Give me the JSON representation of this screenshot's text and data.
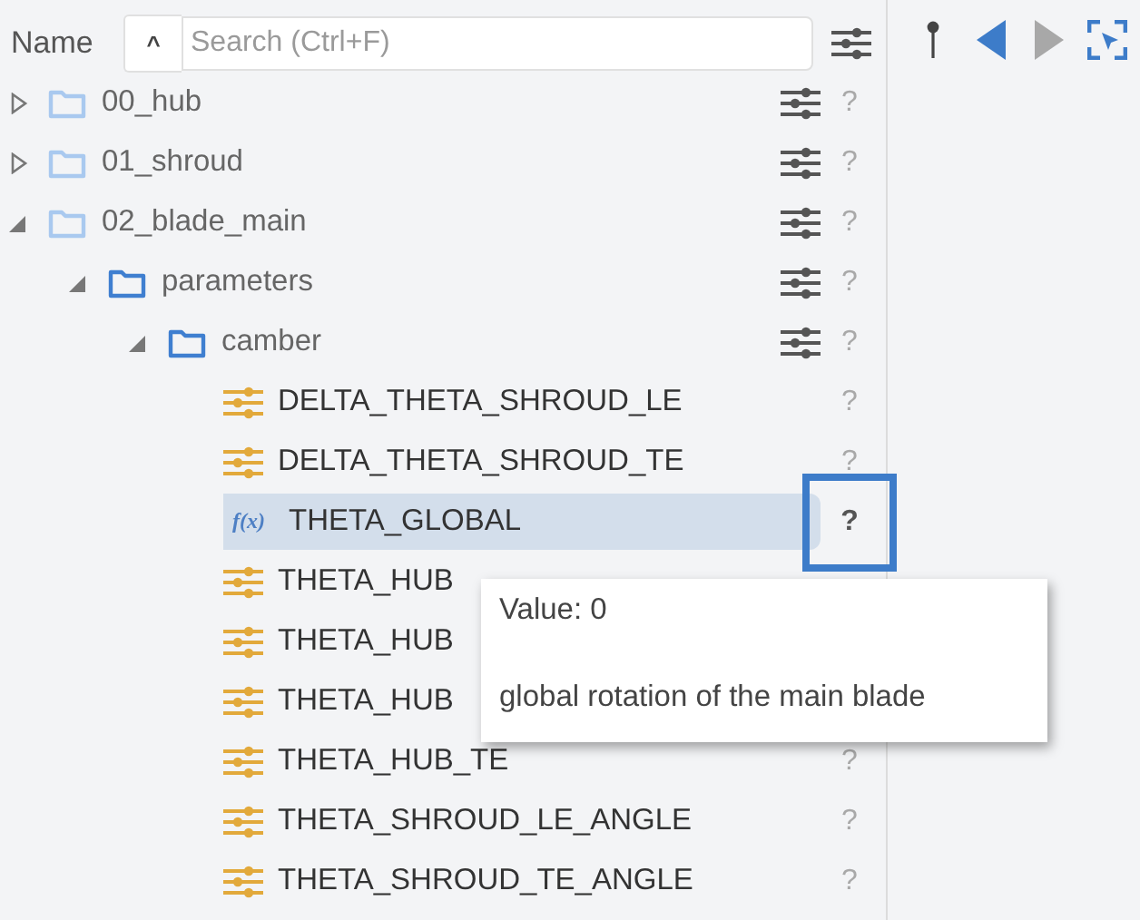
{
  "header": {
    "name_label": "Name",
    "collapse_button": "^",
    "search": {
      "placeholder": "Search (Ctrl+F)"
    }
  },
  "toolbar": [
    {
      "kind": "pin"
    },
    {
      "kind": "back",
      "disabled": false
    },
    {
      "kind": "forward",
      "disabled": true
    },
    {
      "kind": "select"
    }
  ],
  "tree": [
    {
      "kind": "folder",
      "label": "00_hub",
      "expanded": false,
      "selected": false,
      "help": true,
      "strong": false
    },
    {
      "kind": "folder",
      "label": "01_shroud",
      "expanded": false,
      "selected": false,
      "help": true,
      "strong": false
    },
    {
      "kind": "folder",
      "label": "02_blade_main",
      "expanded": true,
      "selected": false,
      "help": true,
      "strong": false,
      "children": [
        {
          "kind": "folder",
          "label": "parameters",
          "expanded": true,
          "selected": false,
          "help": true,
          "strong": true,
          "children": [
            {
              "kind": "folder",
              "label": "camber",
              "expanded": true,
              "selected": false,
              "help": true,
              "strong": true,
              "children": [
                {
                  "kind": "parameter",
                  "label": "DELTA_THETA_SHROUD_LE",
                  "selected": false,
                  "help": true
                },
                {
                  "kind": "parameter",
                  "label": "DELTA_THETA_SHROUD_TE",
                  "selected": false,
                  "help": true
                },
                {
                  "kind": "function",
                  "icon_text": "f(x)",
                  "label": "THETA_GLOBAL",
                  "selected": true,
                  "help": true,
                  "highlighted": true
                },
                {
                  "kind": "parameter",
                  "label": "THETA_HUB",
                  "selected": false,
                  "help": false
                },
                {
                  "kind": "parameter",
                  "label": "THETA_HUB",
                  "selected": false,
                  "help": false
                },
                {
                  "kind": "parameter",
                  "label": "THETA_HUB",
                  "selected": false,
                  "help": false
                },
                {
                  "kind": "parameter",
                  "label": "THETA_HUB_TE",
                  "selected": false,
                  "help": true
                },
                {
                  "kind": "parameter",
                  "label": "THETA_SHROUD_LE_ANGLE",
                  "selected": false,
                  "help": true
                },
                {
                  "kind": "parameter",
                  "label": "THETA_SHROUD_TE_ANGLE",
                  "selected": false,
                  "help": true
                }
              ]
            }
          ]
        }
      ]
    }
  ],
  "help_mark": "?",
  "tooltip": {
    "value": "Value: 0",
    "description": "global rotation of the main blade"
  }
}
